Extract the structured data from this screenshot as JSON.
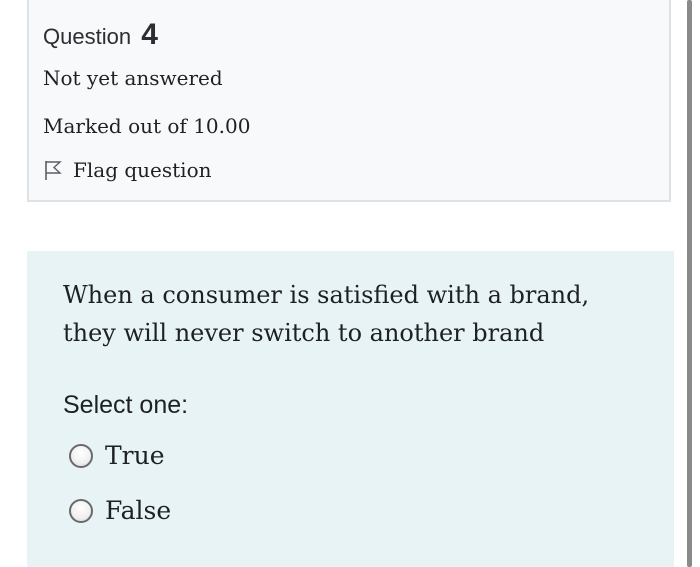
{
  "question_info": {
    "label": "Question",
    "number": "4",
    "status": "Not yet answered",
    "grade": "Marked out of 10.00",
    "flag_label": "Flag question",
    "flag_icon": "flag-outline-icon"
  },
  "question": {
    "text_line1": "When a consumer is satisfied with a brand,",
    "text_line2": "they will never switch to another brand",
    "prompt": "Select one:",
    "options": [
      {
        "label": "True",
        "selected": false
      },
      {
        "label": "False",
        "selected": false
      }
    ]
  },
  "colors": {
    "info_background": "#f8f9fa",
    "info_border": "#dee2e6",
    "content_background": "#e7f3f5",
    "text": "#1d2125"
  }
}
